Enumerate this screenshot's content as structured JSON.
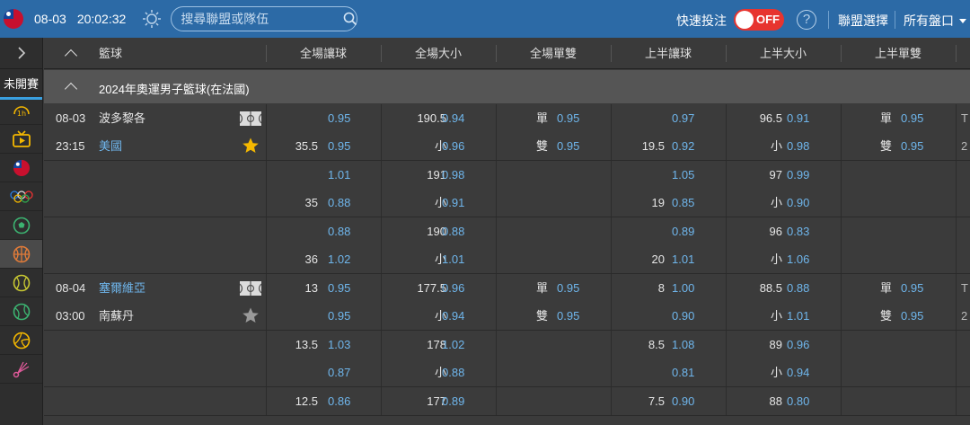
{
  "header": {
    "date": "08-03",
    "time": "20:02:32",
    "search_placeholder": "搜尋聯盟或隊伍",
    "quick_bet": "快速投注",
    "toggle_label": "OFF",
    "help": "?",
    "league_select": "聯盟選擇",
    "handicap_select": "所有盤口"
  },
  "sidebar": {
    "tab": "未開賽",
    "items": [
      "1h-icon",
      "tv-icon",
      "taiwan-flag-icon",
      "olympic-rings-icon",
      "soccer-icon",
      "basketball-icon",
      "tennis-icon",
      "baseball-icon",
      "volleyball-icon",
      "badminton-icon"
    ]
  },
  "columns": {
    "sport": "籃球",
    "headers": [
      "全場讓球",
      "全場大小",
      "全場單雙",
      "上半讓球",
      "上半大小",
      "上半單雙"
    ]
  },
  "league": {
    "name": "2024年奧運男子籃球(在法國)"
  },
  "groups": [
    {
      "lines": [
        {
          "date": "08-03",
          "team": "波多黎各",
          "team_blue": false,
          "ft_hdp": "",
          "ft_hdp_odds": "0.95",
          "ft_ou": "190.5",
          "ft_ou_odds": "0.94",
          "ft_oe": "單",
          "ft_oe_odds": "0.95",
          "h1_hdp": "",
          "h1_hdp_odds": "0.97",
          "h1_ou": "96.5",
          "h1_ou_odds": "0.91",
          "h1_oe": "單",
          "h1_oe_odds": "0.95",
          "extra": "T"
        },
        {
          "date": "23:15",
          "team": "美國",
          "team_blue": true,
          "ft_hdp": "35.5",
          "ft_hdp_odds": "0.95",
          "ft_ou": "小",
          "ft_ou_odds": "0.96",
          "ft_oe": "雙",
          "ft_oe_odds": "0.95",
          "h1_hdp": "19.5",
          "h1_hdp_odds": "0.92",
          "h1_ou": "小",
          "h1_ou_odds": "0.98",
          "h1_oe": "雙",
          "h1_oe_odds": "0.95",
          "extra": "2"
        }
      ],
      "favorite": true
    },
    {
      "lines": [
        {
          "ft_hdp": "",
          "ft_hdp_odds": "1.01",
          "ft_ou": "191",
          "ft_ou_odds": "0.98",
          "h1_hdp": "",
          "h1_hdp_odds": "1.05",
          "h1_ou": "97",
          "h1_ou_odds": "0.99"
        },
        {
          "ft_hdp": "35",
          "ft_hdp_odds": "0.88",
          "ft_ou": "小",
          "ft_ou_odds": "0.91",
          "h1_hdp": "19",
          "h1_hdp_odds": "0.85",
          "h1_ou": "小",
          "h1_ou_odds": "0.90"
        }
      ]
    },
    {
      "lines": [
        {
          "ft_hdp": "",
          "ft_hdp_odds": "0.88",
          "ft_ou": "190",
          "ft_ou_odds": "0.88",
          "h1_hdp": "",
          "h1_hdp_odds": "0.89",
          "h1_ou": "96",
          "h1_ou_odds": "0.83"
        },
        {
          "ft_hdp": "36",
          "ft_hdp_odds": "1.02",
          "ft_ou": "小",
          "ft_ou_odds": "1.01",
          "h1_hdp": "20",
          "h1_hdp_odds": "1.01",
          "h1_ou": "小",
          "h1_ou_odds": "1.06"
        }
      ]
    },
    {
      "lines": [
        {
          "date": "08-04",
          "team": "塞爾維亞",
          "team_blue": true,
          "ft_hdp": "13",
          "ft_hdp_odds": "0.95",
          "ft_ou": "177.5",
          "ft_ou_odds": "0.96",
          "ft_oe": "單",
          "ft_oe_odds": "0.95",
          "h1_hdp": "8",
          "h1_hdp_odds": "1.00",
          "h1_ou": "88.5",
          "h1_ou_odds": "0.88",
          "h1_oe": "單",
          "h1_oe_odds": "0.95",
          "extra": "T"
        },
        {
          "date": "03:00",
          "team": "南蘇丹",
          "team_blue": false,
          "ft_hdp": "",
          "ft_hdp_odds": "0.95",
          "ft_ou": "小",
          "ft_ou_odds": "0.94",
          "ft_oe": "雙",
          "ft_oe_odds": "0.95",
          "h1_hdp": "",
          "h1_hdp_odds": "0.90",
          "h1_ou": "小",
          "h1_ou_odds": "1.01",
          "h1_oe": "雙",
          "h1_oe_odds": "0.95",
          "extra": "2"
        }
      ],
      "favorite": false
    },
    {
      "lines": [
        {
          "ft_hdp": "13.5",
          "ft_hdp_odds": "1.03",
          "ft_ou": "178",
          "ft_ou_odds": "1.02",
          "h1_hdp": "8.5",
          "h1_hdp_odds": "1.08",
          "h1_ou": "89",
          "h1_ou_odds": "0.96"
        },
        {
          "ft_hdp": "",
          "ft_hdp_odds": "0.87",
          "ft_ou": "小",
          "ft_ou_odds": "0.88",
          "h1_hdp": "",
          "h1_hdp_odds": "0.81",
          "h1_ou": "小",
          "h1_ou_odds": "0.94"
        }
      ]
    },
    {
      "lines": [
        {
          "ft_hdp": "12.5",
          "ft_hdp_odds": "0.86",
          "ft_ou": "177",
          "ft_ou_odds": "0.89",
          "h1_hdp": "7.5",
          "h1_hdp_odds": "0.90",
          "h1_ou": "88",
          "h1_ou_odds": "0.80"
        }
      ]
    }
  ],
  "colors": {
    "header_bg": "#2c6aa6",
    "odds_blue": "#6fb6ec",
    "toggle_red": "#e7342f",
    "star_gold": "#f5b800",
    "tab_underline": "#3aa0e0"
  }
}
